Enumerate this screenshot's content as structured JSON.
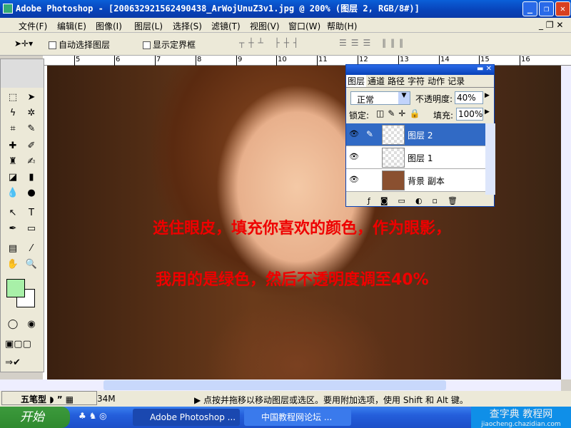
{
  "window": {
    "title": "Adobe Photoshop - [200632921562490438_ArWojUnuZ3v1.jpg @ 200% (图层 2, RGB/8#)]"
  },
  "menu": [
    "文件(F)",
    "编辑(E)",
    "图像(I)",
    "图层(L)",
    "选择(S)",
    "滤镜(T)",
    "视图(V)",
    "窗口(W)",
    "帮助(H)"
  ],
  "options": {
    "auto_select": "自动选择图层",
    "show_bounds": "显示定界框"
  },
  "ruler": [
    "5",
    "6",
    "7",
    "8",
    "9",
    "10",
    "11",
    "12",
    "13",
    "14",
    "15",
    "16"
  ],
  "annotation": {
    "line1": "选住眼皮，填充你喜欢的颜色，作为眼影，",
    "line2": "我用的是绿色，然后不透明度调至40%"
  },
  "colors": {
    "foreground": "#a8f0a8",
    "background": "#ffffff",
    "annotation": "#ee0000"
  },
  "layers_panel": {
    "tabs": [
      "图层",
      "通道",
      "路径",
      "字符",
      "动作",
      "记录"
    ],
    "blend_mode": "正常",
    "opacity_label": "不透明度:",
    "opacity": "40%",
    "lock_label": "锁定:",
    "fill_label": "填充:",
    "fill": "100%",
    "layers": [
      {
        "name": "图层 2",
        "selected": true
      },
      {
        "name": "图层 1",
        "selected": false
      },
      {
        "name": "背景 副本",
        "selected": false
      }
    ]
  },
  "status": {
    "ime": "五笔型",
    "size": "34M",
    "hint": "点按并拖移以移动图层或选区。要用附加选项，使用 Shift 和 Alt 键。"
  },
  "taskbar": {
    "start": "开始",
    "tasks": [
      "Adobe Photoshop ...",
      "中国教程网论坛 ..."
    ],
    "watermark": "查字典 教程网",
    "watermark_url": "jiaocheng.chazidian.com"
  }
}
